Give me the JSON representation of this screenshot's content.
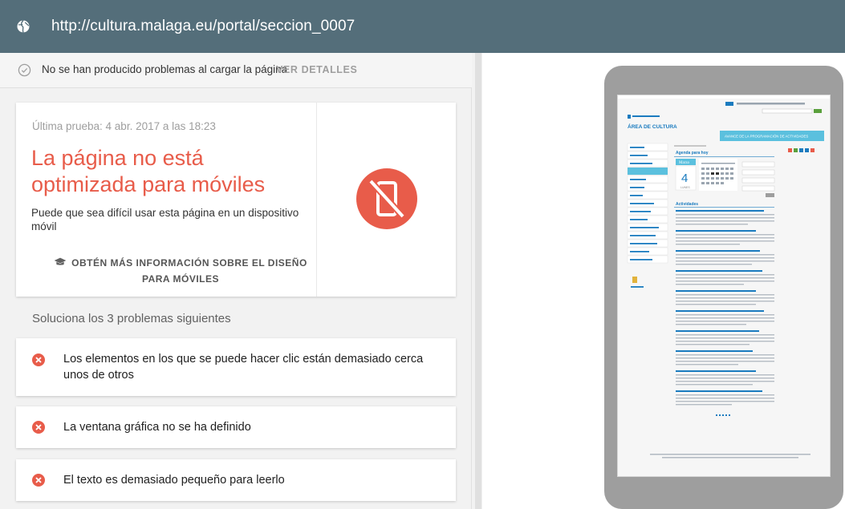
{
  "topbar": {
    "url": "http://cultura.malaga.eu/portal/seccion_0007",
    "icon": "globe-icon"
  },
  "status": {
    "text": "No se han producido problemas al cargar la página",
    "link": "VER DETALLES"
  },
  "result": {
    "test_date": "Última prueba: 4 abr. 2017 a las 18:23",
    "title": "La página no está optimizada para móviles",
    "description": "Puede que sea difícil usar esta página en un dispositivo móvil",
    "learn_more": "OBTÉN MÁS INFORMACIÓN SOBRE EL DISEÑO PARA MÓVILES"
  },
  "problems": {
    "heading": "Soluciona los 3 problemas siguientes",
    "items": [
      {
        "label": "Los elementos en los que se puede hacer clic están demasiado cerca unos de otros"
      },
      {
        "label": "La ventana gráfica no se ha definido"
      },
      {
        "label": "El texto es demasiado pequeño para leerlo"
      }
    ]
  },
  "preview": {
    "site_title": "ÁREA DE CULTURA",
    "banner": "AVANCE DE LA PROGRAMACIÓN DE ACTIVIDADES",
    "agenda_title": "Agenda para hoy",
    "month": "Marzo",
    "day": "4",
    "weekday": "LUNES",
    "activities_heading": "Actividades"
  },
  "colors": {
    "topbar": "#546e7a",
    "error_red": "#e85c4a",
    "site_accent": "#1a7bbf"
  }
}
